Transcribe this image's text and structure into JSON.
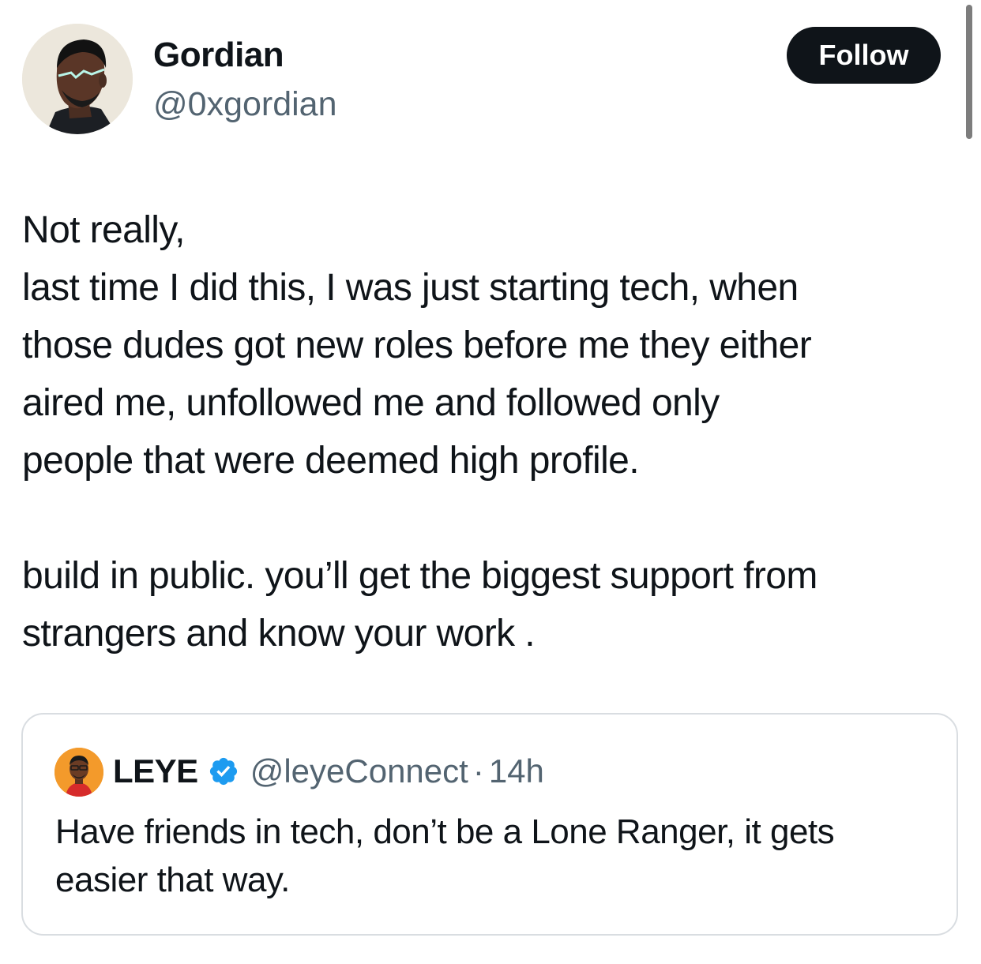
{
  "author": {
    "name": "Gordian",
    "handle": "@0xgordian",
    "avatar_icon": "illustrated-portrait-avatar"
  },
  "follow_button": {
    "label": "Follow"
  },
  "tweet": {
    "paragraph1": {
      "line1": "Not really,",
      "line2": "last time I did this, I was just starting tech, when",
      "line3": "those dudes got new roles before me they either",
      "line4": "aired me, unfollowed me and followed only",
      "line5": "people that were deemed high profile."
    },
    "paragraph2": {
      "line1": "build in public. you’ll get the biggest support from",
      "line2": "strangers and know your work ."
    }
  },
  "quoted_tweet": {
    "author_name": "LEYE",
    "verified_icon": "verified-badge-icon",
    "handle": "@leyeConnect",
    "separator": "·",
    "time": "14h",
    "text_line1": "Have friends in tech, don’t be a Lone Ranger, it gets",
    "text_line2": "easier that way."
  },
  "colors": {
    "text": "#0f1419",
    "secondary_text": "#536471",
    "button_bg": "#0f1419",
    "verified": "#1d9bf0",
    "border": "#d9dde1"
  }
}
